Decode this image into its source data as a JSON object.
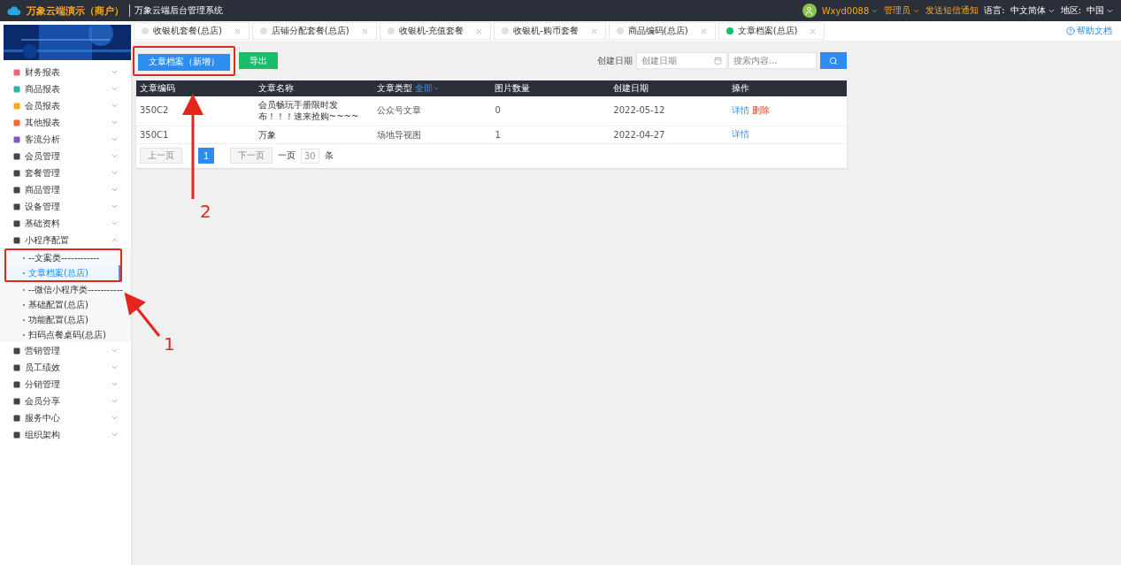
{
  "header": {
    "brand": "万象云端演示（商户）",
    "system": "万象云端后台管理系统",
    "user": "Wxyd0088",
    "role": "管理员",
    "sms": "发送短信通知",
    "language_label": "语言:",
    "language": "中文简体",
    "region_label": "地区:",
    "region": "中国"
  },
  "tabs": [
    {
      "label": "收银机套餐(总店)",
      "selected": false
    },
    {
      "label": "店铺分配套餐(总店)",
      "selected": false
    },
    {
      "label": "收银机-充值套餐",
      "selected": false
    },
    {
      "label": "收银机-购币套餐",
      "selected": false
    },
    {
      "label": "商品编码(总店)",
      "selected": false
    },
    {
      "label": "文章档案(总店)",
      "selected": true
    }
  ],
  "help": "帮助文档",
  "sidebar": {
    "items": [
      {
        "label": "财务报表",
        "expanded": false
      },
      {
        "label": "商品报表",
        "expanded": false
      },
      {
        "label": "会员报表",
        "expanded": false
      },
      {
        "label": "其他报表",
        "expanded": false
      },
      {
        "label": "客流分析",
        "expanded": false
      },
      {
        "label": "会员管理",
        "expanded": false
      },
      {
        "label": "套餐管理",
        "expanded": false
      },
      {
        "label": "商品管理",
        "expanded": false
      },
      {
        "label": "设备管理",
        "expanded": false
      },
      {
        "label": "基础资料",
        "expanded": false
      },
      {
        "label": "小程序配置",
        "expanded": true,
        "children": [
          {
            "label": "--文案类------------",
            "selected": false
          },
          {
            "label": "文章档案(总店)",
            "selected": true
          },
          {
            "label": "--微信小程序类-----------",
            "selected": false
          },
          {
            "label": "基础配置(总店)",
            "selected": false
          },
          {
            "label": "功能配置(总店)",
            "selected": false
          },
          {
            "label": "扫码点餐桌码(总店)",
            "selected": false
          }
        ]
      },
      {
        "label": "营销管理",
        "expanded": false
      },
      {
        "label": "员工绩效",
        "expanded": false
      },
      {
        "label": "分销管理",
        "expanded": false
      },
      {
        "label": "会员分享",
        "expanded": false
      },
      {
        "label": "服务中心",
        "expanded": false
      },
      {
        "label": "组织架构",
        "expanded": false
      }
    ]
  },
  "toolbar": {
    "add": "文章档案（新增）",
    "export": "导出",
    "date_label": "创建日期",
    "date_placeholder": "创建日期",
    "search_placeholder": "搜索内容..."
  },
  "table": {
    "columns": [
      {
        "label": "文章编码"
      },
      {
        "label": "文章名称"
      },
      {
        "label": "文章类型",
        "filter": "全部"
      },
      {
        "label": "图片数量"
      },
      {
        "label": "创建日期"
      },
      {
        "label": "操作"
      }
    ],
    "rows": [
      {
        "code": "350C2",
        "name": "会员畅玩手册限时发布！！！速来抢购~~~~",
        "type": "公众号文章",
        "count": "0",
        "date": "2022-05-12",
        "actions": [
          {
            "label": "详情",
            "kind": "info"
          },
          {
            "label": "删除",
            "kind": "danger"
          }
        ]
      },
      {
        "code": "350C1",
        "name": "万象",
        "type": "场地导视图",
        "count": "1",
        "date": "2022-04-27",
        "actions": [
          {
            "label": "详情",
            "kind": "info"
          }
        ]
      }
    ]
  },
  "pagination": {
    "prev": "上一页",
    "page": "1",
    "next": "下一页",
    "per_page_label": "一页",
    "per_page": "30",
    "unit": "条"
  },
  "annotations": [
    {
      "label": "1"
    },
    {
      "label": "2"
    }
  ]
}
